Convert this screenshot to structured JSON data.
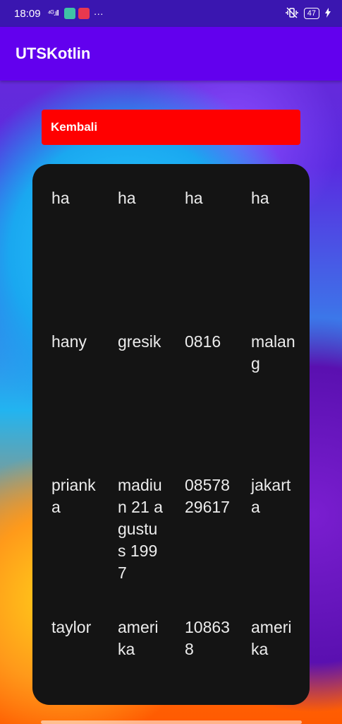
{
  "status_bar": {
    "time": "18:09",
    "signal_text": "⁴ᴳ.ıll",
    "more": "···",
    "battery": "47",
    "icons": [
      "signal-icon",
      "sim-icon",
      "video-icon",
      "vibrate-icon",
      "battery-icon",
      "charging-icon"
    ]
  },
  "app_bar": {
    "title": "UTSKotlin",
    "color": "#6200ee"
  },
  "back_button": {
    "label": "Kembali",
    "color": "#ff0000"
  },
  "table": {
    "rows": [
      [
        "ha",
        "ha",
        "ha",
        "ha"
      ],
      [
        "hany",
        "gresik",
        "0816",
        "malang"
      ],
      [
        "prianka",
        "madiun 21 agustus 1997",
        "0857829617",
        "jakarta"
      ],
      [
        "taylor",
        "amerika",
        "108638",
        "amerika"
      ]
    ]
  }
}
